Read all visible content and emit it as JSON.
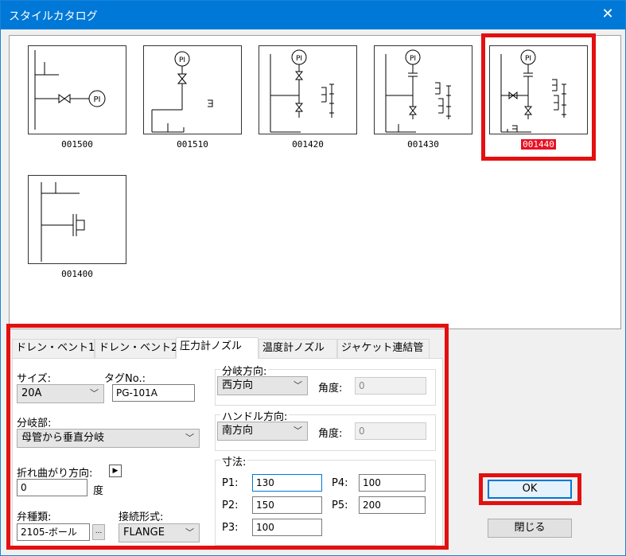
{
  "window": {
    "title": "スタイルカタログ",
    "close_glyph": "✕"
  },
  "catalog": {
    "items": [
      {
        "code": "001500"
      },
      {
        "code": "001510"
      },
      {
        "code": "001420"
      },
      {
        "code": "001430"
      },
      {
        "code": "001440",
        "selected": true
      },
      {
        "code": "001400"
      }
    ]
  },
  "tabs": [
    {
      "label": "ドレン・ベント1"
    },
    {
      "label": "ドレン・ベント2"
    },
    {
      "label": "圧力計ノズル",
      "active": true
    },
    {
      "label": "温度計ノズル"
    },
    {
      "label": "ジャケット連結管"
    }
  ],
  "form": {
    "size_label": "サイズ:",
    "size_value": "20A",
    "tag_label": "タグNo.:",
    "tag_value": "PG-101A",
    "branch_part_label": "分岐部:",
    "branch_part_value": "母管から垂直分岐",
    "bend_dir_label": "折れ曲がり方向:",
    "bend_value": "0",
    "bend_unit": "度",
    "valve_label": "弁種類:",
    "valve_value": "2105-ボール",
    "valve_browse": "...",
    "conn_label": "接続形式:",
    "conn_value": "FLANGE",
    "branch_dir_title": "分岐方向:",
    "branch_dir_value": "西方向",
    "angle_label": "角度:",
    "branch_angle_value": "0",
    "handle_dir_title": "ハンドル方向:",
    "handle_dir_value": "南方向",
    "handle_angle_value": "0",
    "dims_title": "寸法:",
    "p1_label": "P1:",
    "p1_value": "130",
    "p2_label": "P2:",
    "p2_value": "150",
    "p3_label": "P3:",
    "p3_value": "100",
    "p4_label": "P4:",
    "p4_value": "100",
    "p5_label": "P5:",
    "p5_value": "200"
  },
  "buttons": {
    "ok": "OK",
    "close": "閉じる"
  },
  "icons": {
    "dropdown": "chevron-down-icon",
    "play": "play-icon",
    "close": "close-icon"
  },
  "colors": {
    "titlebar": "#0078d7",
    "highlight": "#e31010",
    "selected_caption": "#e81123"
  }
}
